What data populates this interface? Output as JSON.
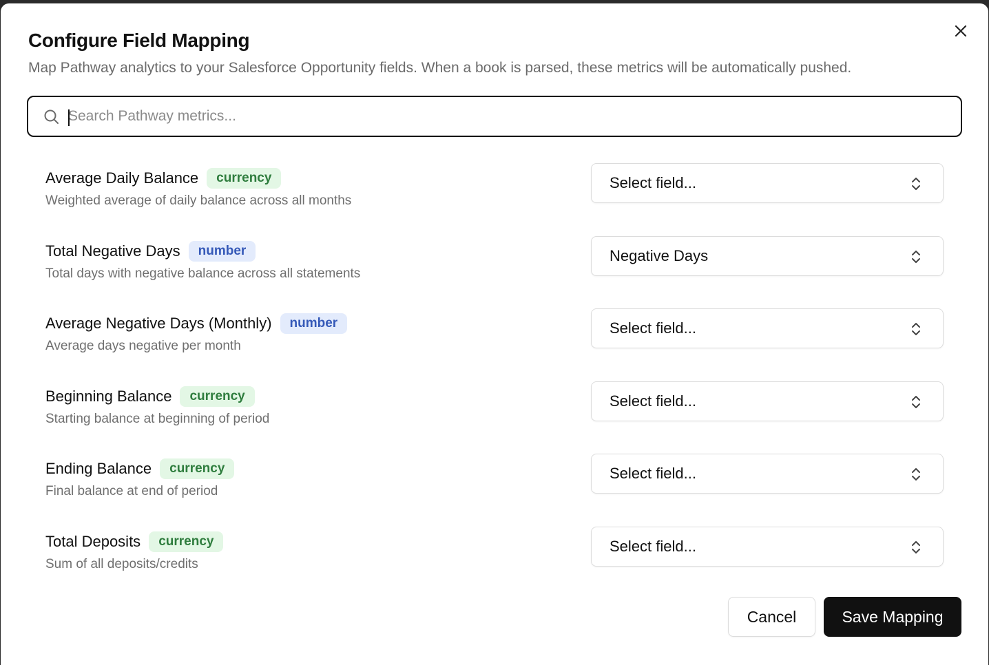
{
  "dialog": {
    "title": "Configure Field Mapping",
    "subtitle": "Map Pathway analytics to your Salesforce Opportunity fields. When a book is parsed, these metrics will be automatically pushed."
  },
  "search": {
    "placeholder": "Search Pathway metrics...",
    "value": ""
  },
  "metrics": [
    {
      "name": "Average Daily Balance",
      "type": "currency",
      "description": "Weighted average of daily balance across all months",
      "selected": "Select field..."
    },
    {
      "name": "Total Negative Days",
      "type": "number",
      "description": "Total days with negative balance across all statements",
      "selected": "Negative Days"
    },
    {
      "name": "Average Negative Days (Monthly)",
      "type": "number",
      "description": "Average days negative per month",
      "selected": "Select field..."
    },
    {
      "name": "Beginning Balance",
      "type": "currency",
      "description": "Starting balance at beginning of period",
      "selected": "Select field..."
    },
    {
      "name": "Ending Balance",
      "type": "currency",
      "description": "Final balance at end of period",
      "selected": "Select field..."
    },
    {
      "name": "Total Deposits",
      "type": "currency",
      "description": "Sum of all deposits/credits",
      "selected": "Select field..."
    }
  ],
  "footer": {
    "cancel_label": "Cancel",
    "save_label": "Save Mapping"
  },
  "icons": {
    "close": "close-icon",
    "search": "search-icon",
    "select": "chevrons-up-down-icon"
  },
  "colors": {
    "primary_button": "#111111",
    "currency_badge_bg": "#e3f7e5",
    "currency_badge_text": "#2f7d3e",
    "number_badge_bg": "#e3ebfc",
    "number_badge_text": "#3559b8"
  }
}
